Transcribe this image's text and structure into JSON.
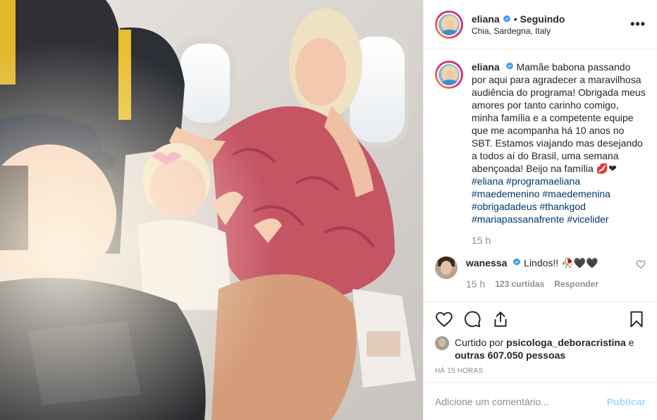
{
  "post": {
    "author": "eliana",
    "follow_status": "Seguindo",
    "separator": "•",
    "location": "Chia, Sardegna, Italy",
    "more_icon": "more-horizontal-icon",
    "caption": {
      "username": "eliana",
      "text": "Mamãe babona passando por aqui para agradecer a maravilhosa audiência do programa! Obrigada meus amores por tanto carinho comigo, minha família e a competente equipe que me acompanha há 10 anos no SBT. Estamos viajando mas desejando a todos aí do Brasil, uma semana abençoada! Beijo na família 💋❤",
      "hashtags": "#eliana #programaeliana #maedemenino #maedemenina #obrigadadeus #thankgod #mariapassanafrente #vicelider",
      "time": "15 h"
    },
    "comment": {
      "username": "wanessa",
      "text": "Lindos!! 🥀🖤🖤",
      "time": "15 h",
      "likes": "123 curtidas",
      "reply": "Responder"
    },
    "likes": {
      "prefix": "Curtido por",
      "user": "psicologa_deboracristina",
      "joiner": "e",
      "others": "outras 607.050 pessoas"
    },
    "timestamp": "HÁ 15 HORAS",
    "add_comment": {
      "placeholder": "Adicione um comentário...",
      "publish": "Publicar"
    }
  },
  "colors": {
    "link": "#00376b",
    "verified": "#3897f0",
    "publish": "#0095f6",
    "muted": "#8e8e8e"
  }
}
